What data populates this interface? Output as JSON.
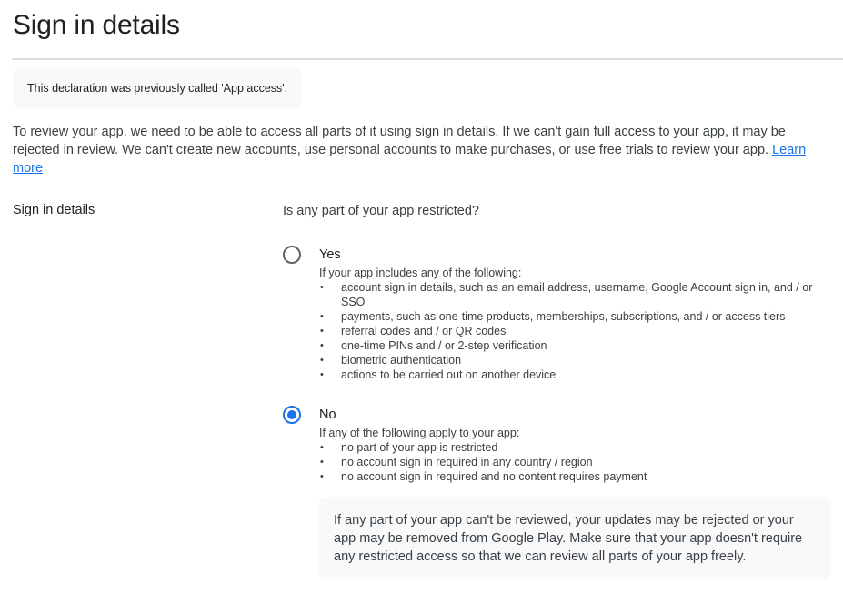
{
  "header": {
    "title": "Sign in details"
  },
  "notice": {
    "text": "This declaration was previously called 'App access'."
  },
  "intro": {
    "text": "To review your app, we need to be able to access all parts of it using sign in details. If we can't gain full access to your app, it may be rejected in review. We can't create new accounts, use personal accounts to make purchases, or use free trials to review your app. ",
    "link": "Learn more"
  },
  "section": {
    "label": "Sign in details",
    "question": "Is any part of your app restricted?"
  },
  "options": {
    "yes": {
      "label": "Yes",
      "selected": false,
      "description": "If your app includes any of the following:",
      "items": [
        "account sign in details, such as an email address, username, Google Account sign in, and / or SSO",
        "payments, such as one-time products, memberships, subscriptions, and / or access tiers",
        "referral codes and / or QR codes",
        "one-time PINs and / or 2-step verification",
        "biometric authentication",
        "actions to be carried out on another device"
      ]
    },
    "no": {
      "label": "No",
      "selected": true,
      "description": "If any of the following apply to your app:",
      "items": [
        "no part of your app is restricted",
        "no account sign in required in any country / region",
        "no account sign in required and no content requires payment"
      ]
    }
  },
  "warning": {
    "text": "If any part of your app can't be reviewed, your updates may be rejected or your app may be removed from Google Play. Make sure that your app doesn't require any restricted access so that we can review all parts of your app freely."
  },
  "colors": {
    "accent": "#1a73e8",
    "text": "#202124",
    "secondary_text": "#3c4043",
    "panel_background": "#f8f9fa",
    "divider": "#dadce0"
  }
}
